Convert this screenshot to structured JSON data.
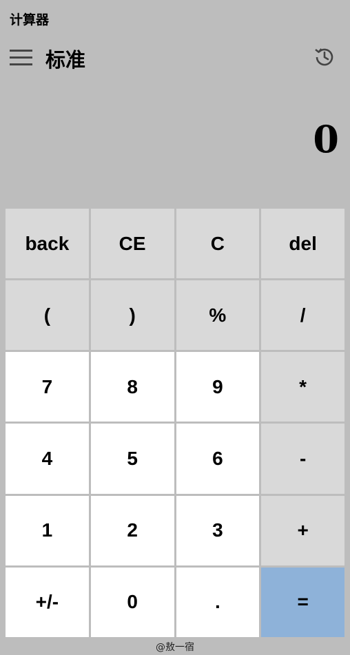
{
  "app": {
    "title": "计算器"
  },
  "header": {
    "mode": "标准",
    "menu_icon": "hamburger-menu-icon",
    "history_icon": "history-icon"
  },
  "display": {
    "value": "0"
  },
  "keys": [
    {
      "label": "back",
      "style": "light"
    },
    {
      "label": "CE",
      "style": "light"
    },
    {
      "label": "C",
      "style": "light"
    },
    {
      "label": "del",
      "style": "light"
    },
    {
      "label": "(",
      "style": "light"
    },
    {
      "label": ")",
      "style": "light"
    },
    {
      "label": "%",
      "style": "light"
    },
    {
      "label": "/",
      "style": "light"
    },
    {
      "label": "7",
      "style": "white"
    },
    {
      "label": "8",
      "style": "white"
    },
    {
      "label": "9",
      "style": "white"
    },
    {
      "label": "*",
      "style": "light"
    },
    {
      "label": "4",
      "style": "white"
    },
    {
      "label": "5",
      "style": "white"
    },
    {
      "label": "6",
      "style": "white"
    },
    {
      "label": "-",
      "style": "light"
    },
    {
      "label": "1",
      "style": "white"
    },
    {
      "label": "2",
      "style": "white"
    },
    {
      "label": "3",
      "style": "white"
    },
    {
      "label": "+",
      "style": "light"
    },
    {
      "label": "+/-",
      "style": "white"
    },
    {
      "label": "0",
      "style": "white"
    },
    {
      "label": ".",
      "style": "white"
    },
    {
      "label": "=",
      "style": "equals"
    }
  ],
  "colors": {
    "background": "#bdbdbd",
    "key_light": "#d9d9d9",
    "key_white": "#ffffff",
    "key_equals": "#8eb2d9"
  },
  "footer": {
    "credit": "@敖一宿"
  }
}
